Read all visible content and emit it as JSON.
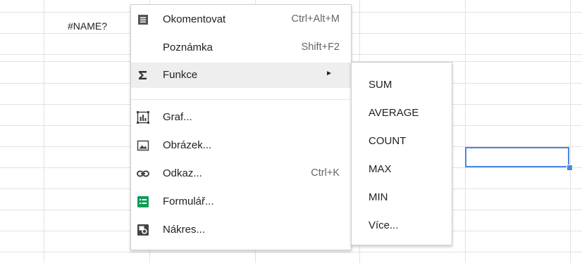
{
  "cell": {
    "value": "#NAME?"
  },
  "menu": {
    "items": [
      {
        "label": "Okomentovat",
        "shortcut": "Ctrl+Alt+M",
        "icon": "comment-icon"
      },
      {
        "label": "Poznámka",
        "shortcut": "Shift+F2",
        "icon": ""
      },
      {
        "label": "Funkce",
        "shortcut": "",
        "icon": "sigma-icon",
        "submenu_arrow": "►"
      },
      {
        "label": "Graf...",
        "shortcut": "",
        "icon": "chart-icon"
      },
      {
        "label": "Obrázek...",
        "shortcut": "",
        "icon": "image-icon"
      },
      {
        "label": "Odkaz...",
        "shortcut": "Ctrl+K",
        "icon": "link-icon"
      },
      {
        "label": "Formulář...",
        "shortcut": "",
        "icon": "form-icon"
      },
      {
        "label": "Nákres...",
        "shortcut": "",
        "icon": "drawing-icon"
      }
    ]
  },
  "submenu": {
    "items": [
      {
        "label": "SUM"
      },
      {
        "label": "AVERAGE"
      },
      {
        "label": "COUNT"
      },
      {
        "label": "MAX"
      },
      {
        "label": "MIN"
      },
      {
        "label": "Více..."
      }
    ]
  },
  "colors": {
    "selection": "#4a86e8",
    "form_icon": "#0f9d58"
  }
}
